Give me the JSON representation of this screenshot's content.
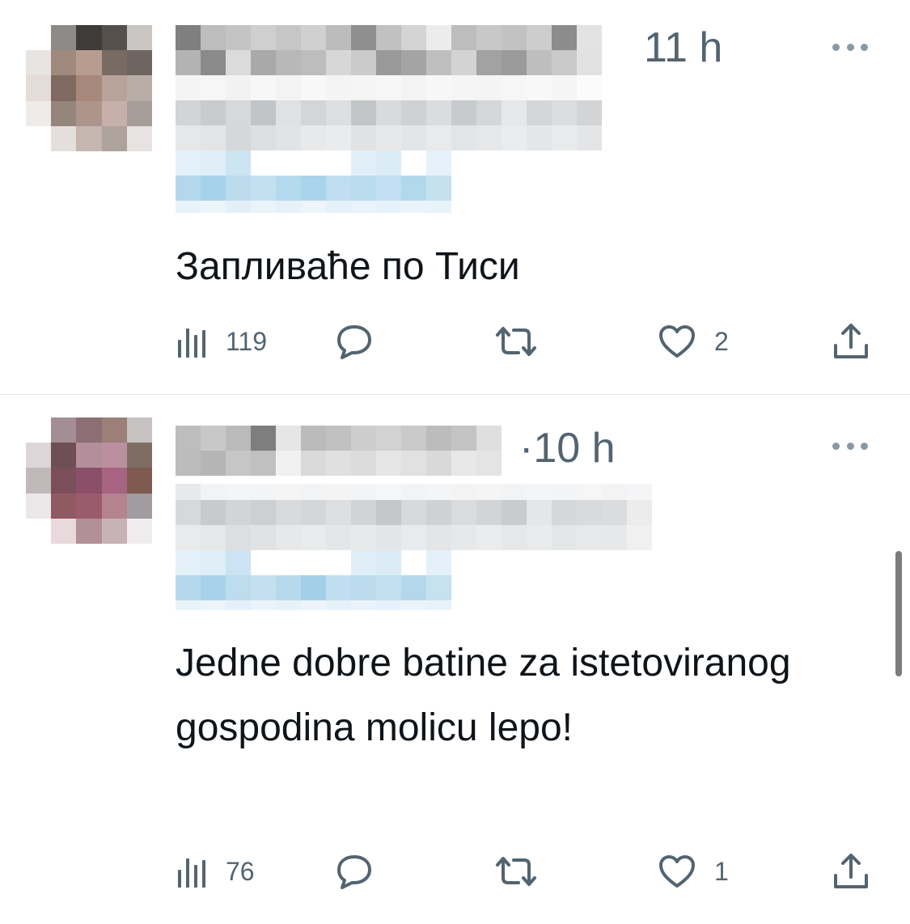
{
  "tweets": [
    {
      "time": "11 h",
      "text": "Запливаће по Тиси",
      "views": "119",
      "likes": "2"
    },
    {
      "time": "·10 h",
      "text": "Jedne dobre batine za istetoviranog gospodina molicu lepo!",
      "views": "76",
      "likes": "1"
    }
  ],
  "colors": {
    "icon": "#536471",
    "text": "#0f1419",
    "link_blur": "#a9d4ea"
  },
  "icons": [
    "views-icon",
    "reply-icon",
    "retweet-icon",
    "like-icon",
    "share-icon",
    "more-icon"
  ]
}
